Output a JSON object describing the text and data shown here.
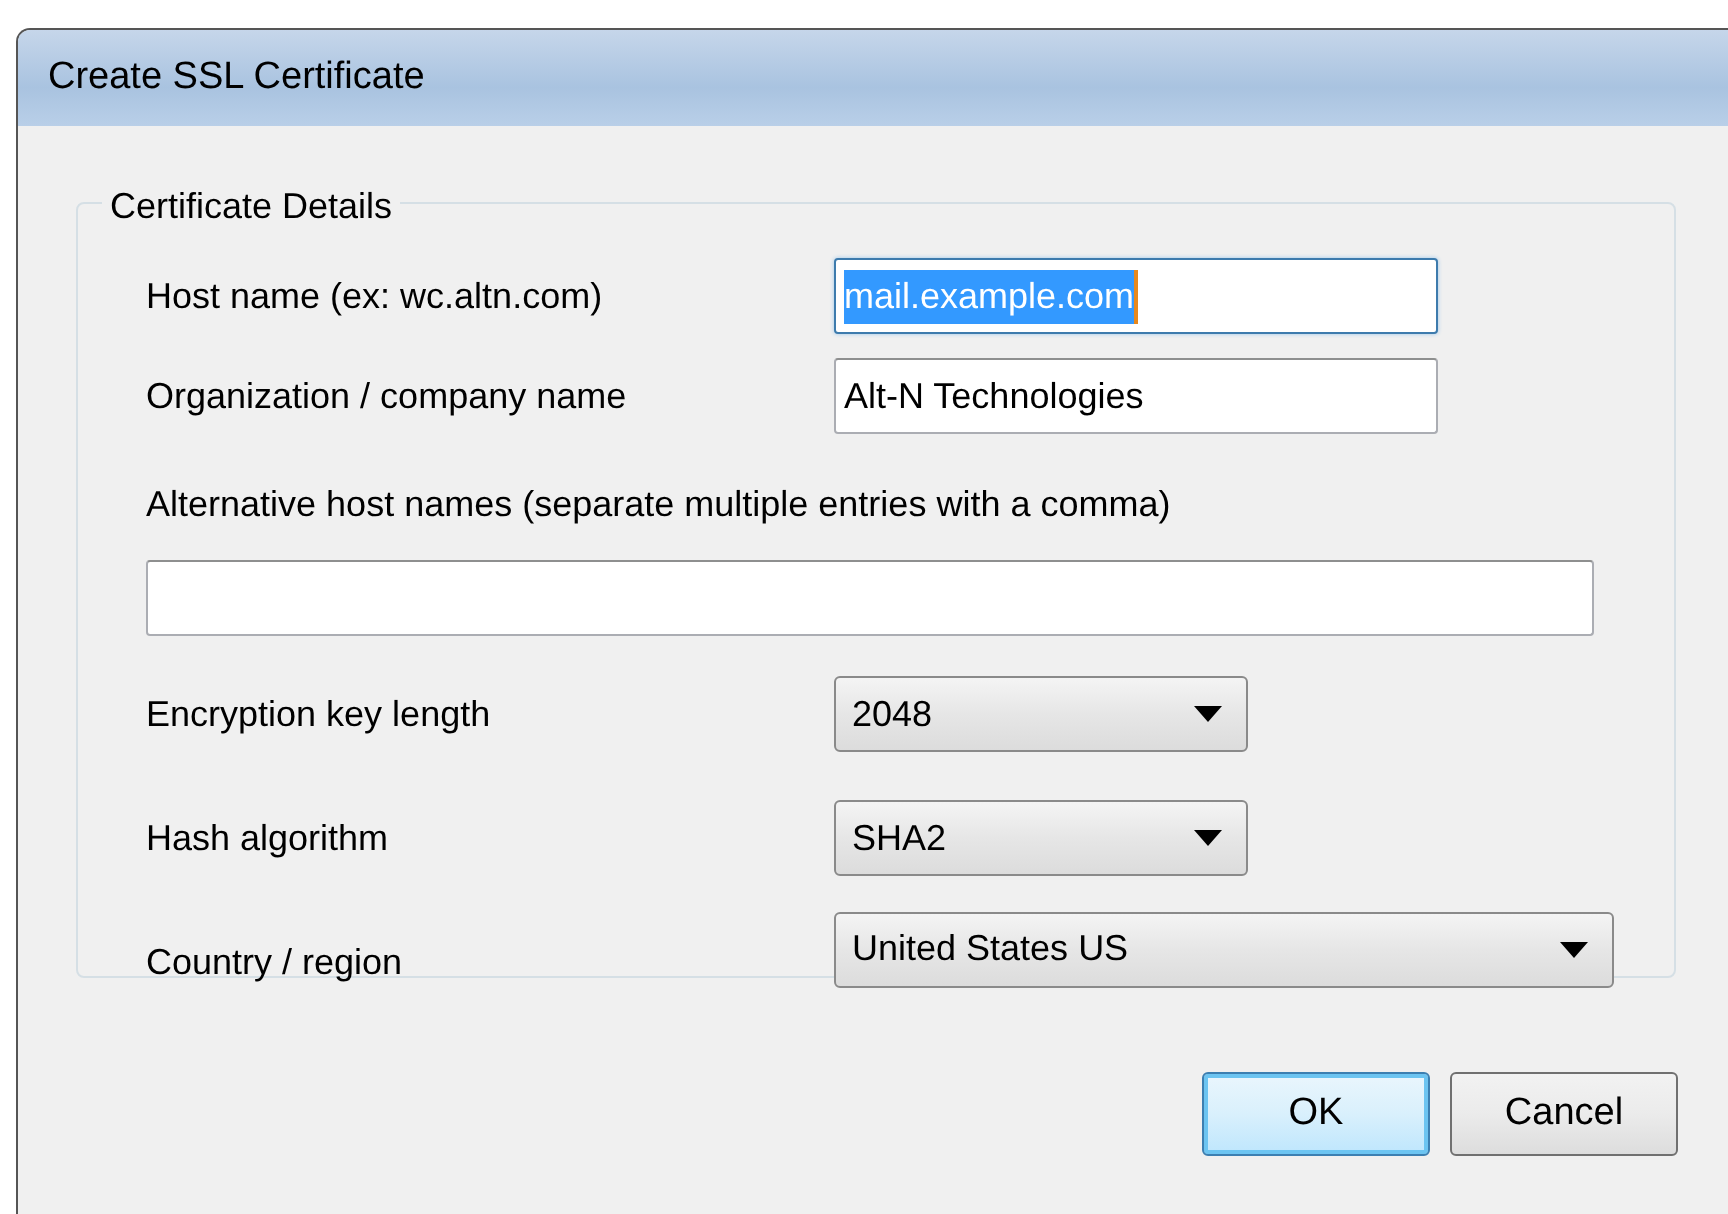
{
  "window": {
    "title": "Create SSL Certificate"
  },
  "group": {
    "title": "Certificate Details"
  },
  "fields": [
    {
      "kind": "text",
      "label": "Host name (ex: wc.altn.com)",
      "value": "mail.example.com",
      "focused": true
    },
    {
      "kind": "text",
      "label": "Organization / company name",
      "value": "Alt-N Technologies",
      "focused": false
    },
    {
      "kind": "wide_text",
      "label": "Alternative host names (separate multiple entries with a comma)",
      "focused": false
    },
    {
      "kind": "select",
      "label": "Encryption key length",
      "value": "2048"
    },
    {
      "kind": "select",
      "label": "Hash algorithm",
      "value": "SHA2"
    },
    {
      "kind": "wide_select",
      "label": "Country / region",
      "value": "United States US"
    }
  ],
  "buttons": [
    {
      "label": "OK",
      "default": true
    },
    {
      "label": "Cancel",
      "default": false
    }
  ]
}
